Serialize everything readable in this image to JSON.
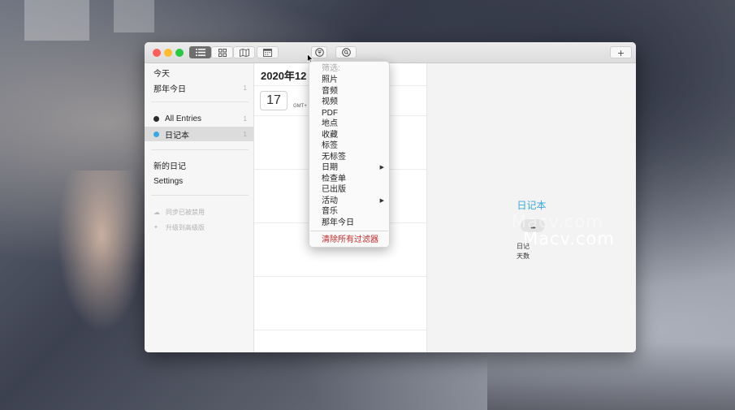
{
  "toolbar": {
    "view_buttons": [
      "list-view-icon",
      "grid-view-icon",
      "map-view-icon",
      "calendar-view-icon"
    ],
    "filter_icon": "filter-icon",
    "search_icon": "search-icon",
    "add_label": "+"
  },
  "sidebar": {
    "items": [
      {
        "label": "今天",
        "count": ""
      },
      {
        "label": "那年今日",
        "count": "1"
      }
    ],
    "journals": [
      {
        "label": "All Entries",
        "count": "1",
        "color": "#2b2b2b"
      },
      {
        "label": "日记本",
        "count": "1",
        "color": "#36a9e1",
        "selected": true
      }
    ],
    "actions": [
      "新的日记",
      "Settings"
    ],
    "footer": [
      "同步已被禁用",
      "升级到高级版"
    ]
  },
  "list": {
    "month_header": "2020年12",
    "day": "17",
    "tz": "GMT+"
  },
  "detail": {
    "journal_name": "日记本",
    "more_label": "•••",
    "stat1": "日记",
    "stat2": "天数"
  },
  "filter_menu": {
    "title": "筛选:",
    "items": [
      {
        "label": "照片"
      },
      {
        "label": "音频"
      },
      {
        "label": "视频"
      },
      {
        "label": "PDF"
      },
      {
        "label": "地点"
      },
      {
        "label": "收藏"
      },
      {
        "label": "标签"
      },
      {
        "label": "无标签"
      },
      {
        "label": "日期",
        "submenu": true
      },
      {
        "label": "检查单"
      },
      {
        "label": "已出版"
      },
      {
        "label": "活动",
        "submenu": true
      },
      {
        "label": "音乐"
      },
      {
        "label": "那年今日"
      }
    ],
    "clear_label": "清除所有过滤器"
  },
  "watermark": {
    "text1": "Macv.com",
    "text2": "Macv.com"
  },
  "colors": {
    "accent": "#36a9e1",
    "clear_red": "#c62828",
    "close": "#fc5f57",
    "minimize": "#fdbc2e",
    "zoom": "#28c840"
  }
}
